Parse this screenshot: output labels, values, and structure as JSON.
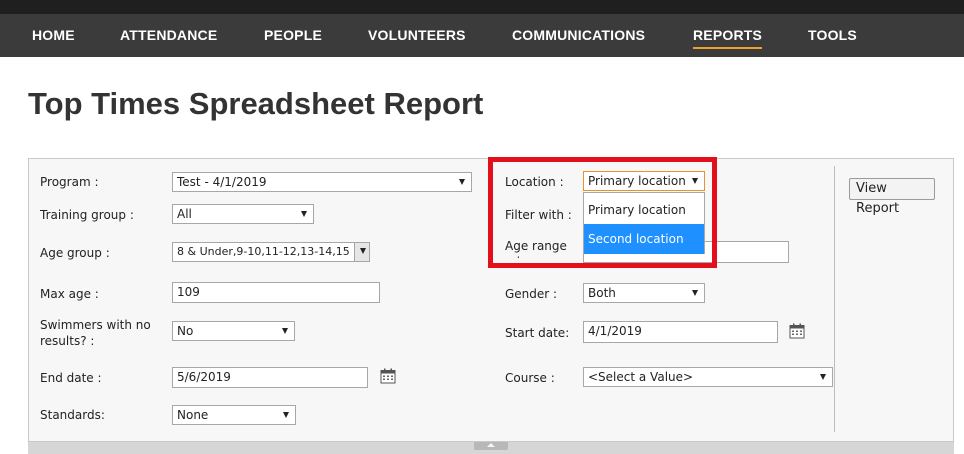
{
  "nav": {
    "items": [
      {
        "label": "HOME"
      },
      {
        "label": "ATTENDANCE"
      },
      {
        "label": "PEOPLE"
      },
      {
        "label": "VOLUNTEERS"
      },
      {
        "label": "COMMUNICATIONS"
      },
      {
        "label": "REPORTS",
        "active": true
      },
      {
        "label": "TOOLS"
      }
    ],
    "active_color": "#f0a030"
  },
  "page": {
    "title": "Top Times Spreadsheet Report"
  },
  "form": {
    "program": {
      "label": "Program :",
      "value": "Test - 4/1/2019"
    },
    "training_group": {
      "label": "Training group :",
      "value": "All"
    },
    "age_group": {
      "label": "Age group :",
      "value": "8 & Under,9-10,11-12,13-14,15 &"
    },
    "max_age": {
      "label": "Max age :",
      "value": "109"
    },
    "swimmers_no_results": {
      "label": "Swimmers with no results? :",
      "value": "No"
    },
    "end_date": {
      "label": "End date :",
      "value": "5/6/2019"
    },
    "standards": {
      "label": "Standards:",
      "value": "None"
    },
    "location": {
      "label": "Location :",
      "value": "Primary location",
      "options": [
        "Primary location",
        "Second location"
      ],
      "highlighted_option": "Second location"
    },
    "filter_with": {
      "label": "Filter with :"
    },
    "age_range": {
      "label": "Age range min:"
    },
    "gender": {
      "label": "Gender :",
      "value": "Both"
    },
    "start_date": {
      "label": "Start date:",
      "value": "4/1/2019"
    },
    "course": {
      "label": "Course :",
      "value": "<Select a Value>"
    },
    "view_report": {
      "label": "View Report"
    }
  },
  "icons": {
    "calendar": "calendar-icon",
    "dropdown": "chevron-down-icon"
  },
  "colors": {
    "highlight_box": "#e3101c",
    "selected_option": "#1e90ff",
    "focus_border": "#e59430"
  }
}
